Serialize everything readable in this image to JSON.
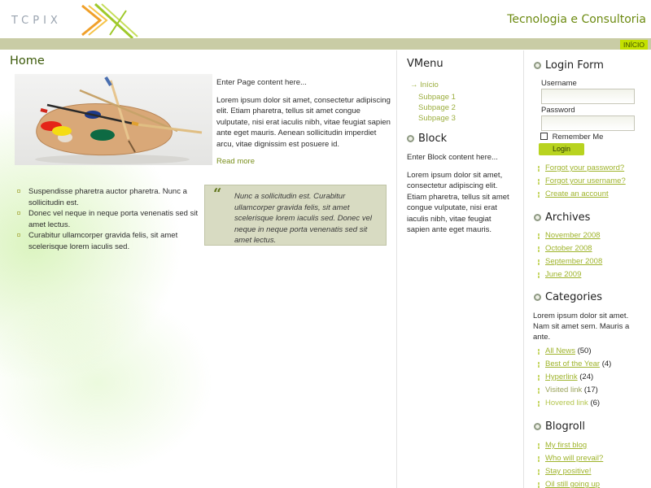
{
  "header": {
    "logo_text": "TCPIX",
    "slogan": "Tecnologia e Consultoria",
    "nav": [
      {
        "label": "INÍCIO"
      }
    ]
  },
  "content": {
    "title": "Home",
    "intro_lead": "Enter Page content here...",
    "intro_paragraph": "Lorem ipsum dolor sit amet, consectetur adipiscing elit. Etiam pharetra, tellus sit amet congue vulputate, nisi erat iaculis nibh, vitae feugiat sapien ante eget mauris. Aenean sollicitudin imperdiet arcu, vitae dignissim est posuere id.",
    "read_more": "Read more",
    "bullets": [
      "Suspendisse pharetra auctor pharetra. Nunc a sollicitudin est.",
      "Donec vel neque in neque porta venenatis sed sit amet lectus.",
      "Curabitur ullamcorper gravida felis, sit amet scelerisque lorem iaculis sed."
    ],
    "quote": "Nunc a sollicitudin est. Curabitur ullamcorper gravida felis, sit amet scelerisque lorem iaculis sed. Donec vel neque in neque porta venenatis sed sit amet lectus.",
    "quote_mark": "“"
  },
  "vmenu": {
    "title": "VMenu",
    "items": [
      {
        "label": "→ Início"
      },
      {
        "label": "Subpage 1"
      },
      {
        "label": "Subpage 2"
      },
      {
        "label": "Subpage 3"
      }
    ]
  },
  "block": {
    "title": "Block",
    "lead": "Enter Block content here...",
    "text": "Lorem ipsum dolor sit amet, consectetur adipiscing elit. Etiam pharetra, tellus sit amet congue vulputate, nisi erat iaculis nibh, vitae feugiat sapien ante eget mauris."
  },
  "login": {
    "title": "Login Form",
    "username_label": "Username",
    "password_label": "Password",
    "remember_label": "Remember Me",
    "button": "Login",
    "links": [
      "Forgot your password?",
      "Forgot your username?",
      "Create an account"
    ]
  },
  "archives": {
    "title": "Archives",
    "items": [
      "November 2008",
      "October 2008",
      "September 2008",
      "June 2009"
    ]
  },
  "categories": {
    "title": "Categories",
    "intro": "Lorem ipsum dolor sit amet. Nam sit amet sem. Mauris a ante.",
    "items": [
      {
        "label": "All News",
        "count": "(50)",
        "style": "link"
      },
      {
        "label": "Best of the Year",
        "count": "(4)",
        "style": "link"
      },
      {
        "label": "Hyperlink",
        "count": "(24)",
        "style": "link"
      },
      {
        "label": "Visited link",
        "count": "(17)",
        "style": "visited"
      },
      {
        "label": "Hovered link",
        "count": "(6)",
        "style": "hovered"
      }
    ]
  },
  "blogroll": {
    "title": "Blogroll",
    "items": [
      "My first blog",
      "Who will prevail?",
      "Stay positive!",
      "Oil still going up"
    ]
  },
  "colors": {
    "accent": "#b8d320",
    "link": "#9fb42c",
    "nav_bar": "#c9cca5",
    "quote_bg": "#d8dbc2",
    "title_green": "#6c8a10"
  }
}
